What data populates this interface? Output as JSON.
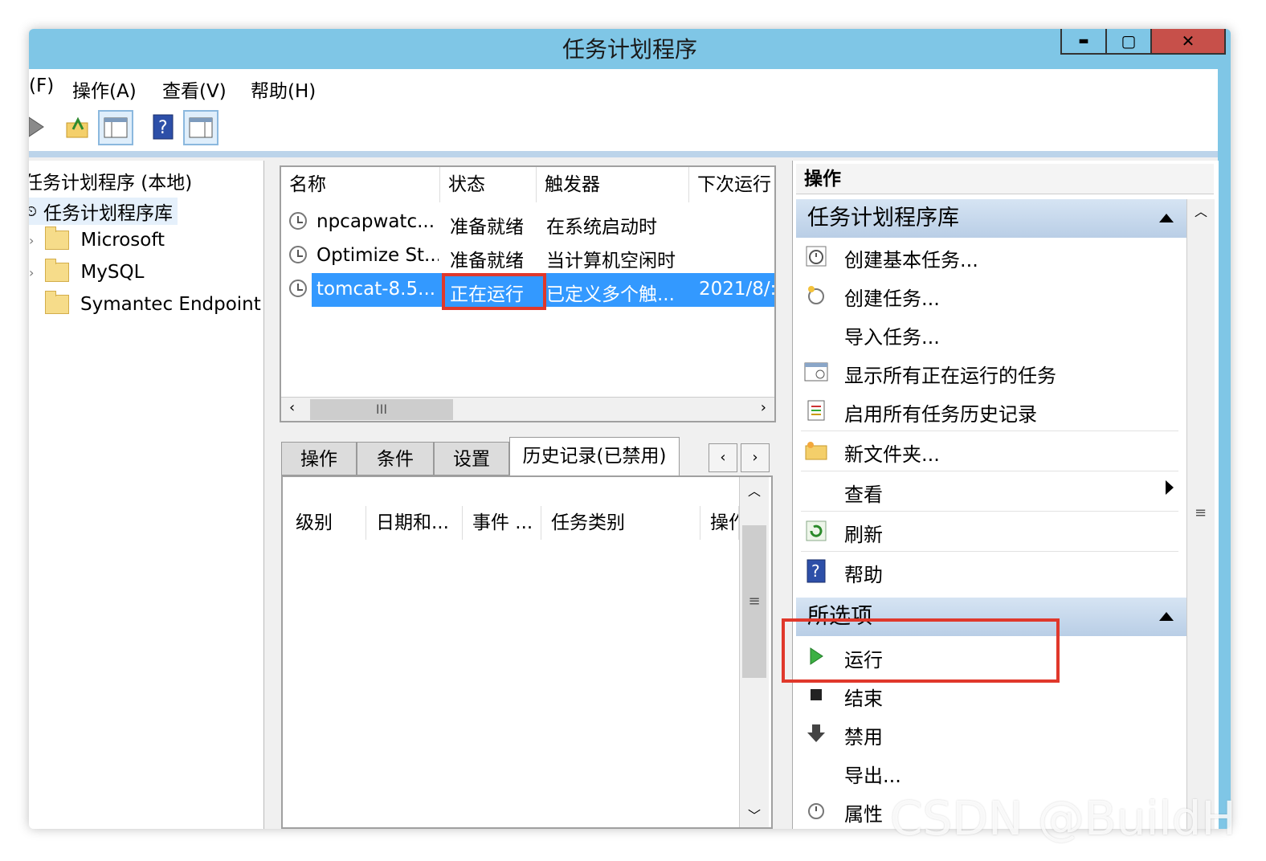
{
  "window": {
    "title": "任务计划程序",
    "buttons": {
      "minimize": "▬",
      "maximize": "▢",
      "close": "✕"
    }
  },
  "menubar": {
    "items": [
      "(F)",
      "操作(A)",
      "查看(V)",
      "帮助(H)"
    ]
  },
  "toolbar": {
    "icons": [
      "forward-arrow-icon",
      "folder-up-icon",
      "show-console-tree-icon",
      "help-icon",
      "show-action-pane-icon"
    ]
  },
  "tree": {
    "root": "任务计划程序 (本地)",
    "library": "任务计划程序库",
    "folders": [
      "Microsoft",
      "MySQL",
      "Symantec Endpoint"
    ]
  },
  "tasklist": {
    "columns": [
      "名称",
      "状态",
      "触发器",
      "下次运行"
    ],
    "rows": [
      {
        "name": "npcapwatc...",
        "status": "准备就绪",
        "trigger": "在系统启动时",
        "next": ""
      },
      {
        "name": "Optimize St...",
        "status": "准备就绪",
        "trigger": "当计算机空闲时",
        "next": ""
      },
      {
        "name": "tomcat-8.5...",
        "status": "正在运行",
        "trigger": "已定义多个触...",
        "next": "2021/8/:"
      }
    ],
    "scroll_thumb": "III"
  },
  "detail_tabs": {
    "tabs": [
      "操作",
      "条件",
      "设置",
      "历史记录(已禁用)"
    ],
    "nav": [
      "‹",
      "›"
    ],
    "history_columns": [
      "级别",
      "日期和...",
      "事件 ...",
      "任务类别",
      "操作"
    ],
    "scroll_thumb": "≡"
  },
  "actions": {
    "title": "操作",
    "library_section": "任务计划程序库",
    "library_items": [
      "创建基本任务...",
      "创建任务...",
      "导入任务...",
      "显示所有正在运行的任务",
      "启用所有任务历史记录",
      "新文件夹...",
      "查看",
      "刷新",
      "帮助"
    ],
    "selected_section": "所选项",
    "selected_items": [
      "运行",
      "结束",
      "禁用",
      "导出...",
      "属性"
    ],
    "scroll_thumb": "≡"
  },
  "watermark": "CSDN @BuildH",
  "colors": {
    "titlebar": "#7fc6e6",
    "selection": "#3399ff",
    "highlight": "#e0382b"
  }
}
